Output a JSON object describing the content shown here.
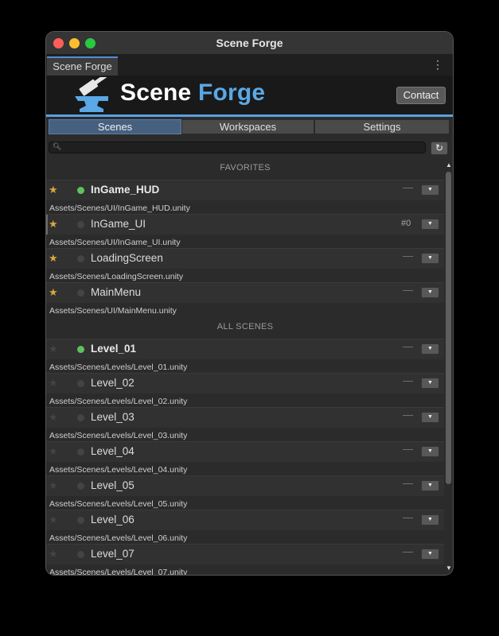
{
  "window": {
    "title": "Scene Forge"
  },
  "tab": {
    "label": "Scene Forge",
    "menu_icon": "kebab-icon"
  },
  "banner": {
    "logo_word1": "Scene",
    "logo_word2": "Forge",
    "contact_label": "Contact",
    "accent_color": "#5aa8e6"
  },
  "nav": {
    "tabs": [
      "Scenes",
      "Workspaces",
      "Settings"
    ],
    "active": "Scenes"
  },
  "search": {
    "value": "",
    "placeholder": ""
  },
  "sections": {
    "favorites": "FAVORITES",
    "all": "ALL SCENES"
  },
  "favorites": [
    {
      "name": "InGame_HUD",
      "path": "Assets/Scenes/UI/InGame_HUD.unity",
      "favorite": true,
      "loaded": true,
      "bold": true,
      "status": "—"
    },
    {
      "name": "InGame_UI",
      "path": "Assets/Scenes/UI/InGame_UI.unity",
      "favorite": true,
      "loaded": false,
      "bold": false,
      "status": "#0"
    },
    {
      "name": "LoadingScreen",
      "path": "Assets/Scenes/LoadingScreen.unity",
      "favorite": true,
      "loaded": false,
      "bold": false,
      "status": "—"
    },
    {
      "name": "MainMenu",
      "path": "Assets/Scenes/UI/MainMenu.unity",
      "favorite": true,
      "loaded": false,
      "bold": false,
      "status": "—"
    }
  ],
  "all_scenes": [
    {
      "name": "Level_01",
      "path": "Assets/Scenes/Levels/Level_01.unity",
      "favorite": false,
      "loaded": true,
      "bold": true,
      "status": "—"
    },
    {
      "name": "Level_02",
      "path": "Assets/Scenes/Levels/Level_02.unity",
      "favorite": false,
      "loaded": false,
      "bold": false,
      "status": "—"
    },
    {
      "name": "Level_03",
      "path": "Assets/Scenes/Levels/Level_03.unity",
      "favorite": false,
      "loaded": false,
      "bold": false,
      "status": "—"
    },
    {
      "name": "Level_04",
      "path": "Assets/Scenes/Levels/Level_04.unity",
      "favorite": false,
      "loaded": false,
      "bold": false,
      "status": "—"
    },
    {
      "name": "Level_05",
      "path": "Assets/Scenes/Levels/Level_05.unity",
      "favorite": false,
      "loaded": false,
      "bold": false,
      "status": "—"
    },
    {
      "name": "Level_06",
      "path": "Assets/Scenes/Levels/Level_06.unity",
      "favorite": false,
      "loaded": false,
      "bold": false,
      "status": "—"
    },
    {
      "name": "Level_07",
      "path": "Assets/Scenes/Levels/Level_07.unity",
      "favorite": false,
      "loaded": false,
      "bold": false,
      "status": "—"
    }
  ],
  "icons": {
    "star": "star-icon",
    "loaded_dot": "loaded-indicator-icon",
    "dropdown": "dropdown-arrow-icon",
    "refresh": "refresh-icon",
    "search": "search-icon"
  },
  "colors": {
    "star_favorite": "#d6a93b",
    "loaded_green": "#5fc15b",
    "active_tab": "#46607f"
  }
}
